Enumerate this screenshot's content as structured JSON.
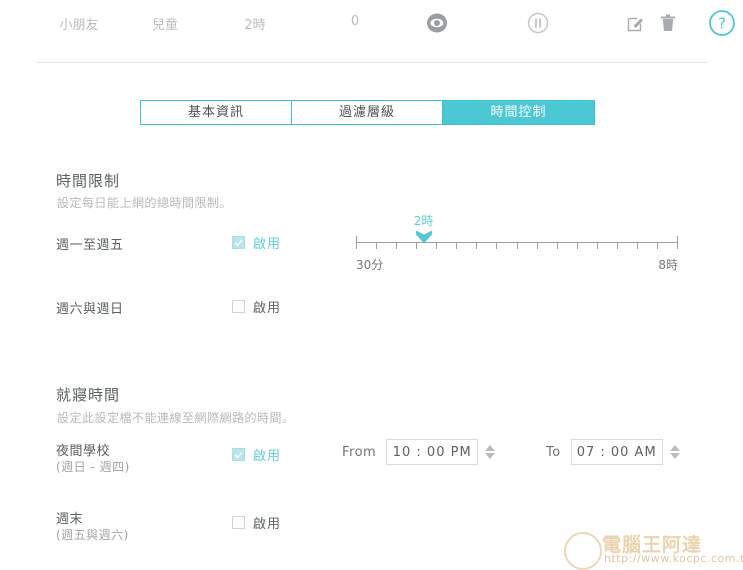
{
  "header": {
    "profile_name": "小朋友",
    "profile_group": "兒童",
    "time_limit": "2時",
    "device_count": "0",
    "icons": {
      "eye": "eye-icon",
      "pause": "pause-icon",
      "edit": "edit-icon",
      "trash": "trash-icon",
      "help": "help-icon"
    }
  },
  "tabs": [
    {
      "label": "基本資訊",
      "active": false
    },
    {
      "label": "過濾層級",
      "active": false
    },
    {
      "label": "時間控制",
      "active": true
    }
  ],
  "time_limit_section": {
    "title": "時間限制",
    "subtitle": "設定每日能上網的總時間限制。",
    "weekday": {
      "label": "週一至週五",
      "enable_label": "啟用",
      "checked": true
    },
    "weekend": {
      "label": "週六與週日",
      "enable_label": "啟用",
      "checked": false
    },
    "slider": {
      "value_label": "2時",
      "min_label": "30分",
      "max_label": "8時",
      "value_percent": 21,
      "tick_count": 16
    }
  },
  "bedtime_section": {
    "title": "就寢時間",
    "subtitle": "設定此設定檔不能連線至網際網路的時間。",
    "school_night": {
      "label": "夜間學校",
      "sublabel": "(週日 - 週四)",
      "enable_label": "啟用",
      "checked": true,
      "from_caption": "From",
      "from_value": "10 : 00  PM",
      "to_caption": "To",
      "to_value": "07 : 00  AM"
    },
    "weekend_night": {
      "label": "週末",
      "sublabel": "(週五與週六)",
      "enable_label": "啟用",
      "checked": false
    }
  },
  "watermark": {
    "brand": "電腦王阿達",
    "url": "http://www.kocpc.com.tw"
  },
  "colors": {
    "accent": "#4cc7d4",
    "accent_light": "#5ccdd9",
    "text": "#5a6063",
    "muted": "#b5b9bc"
  }
}
